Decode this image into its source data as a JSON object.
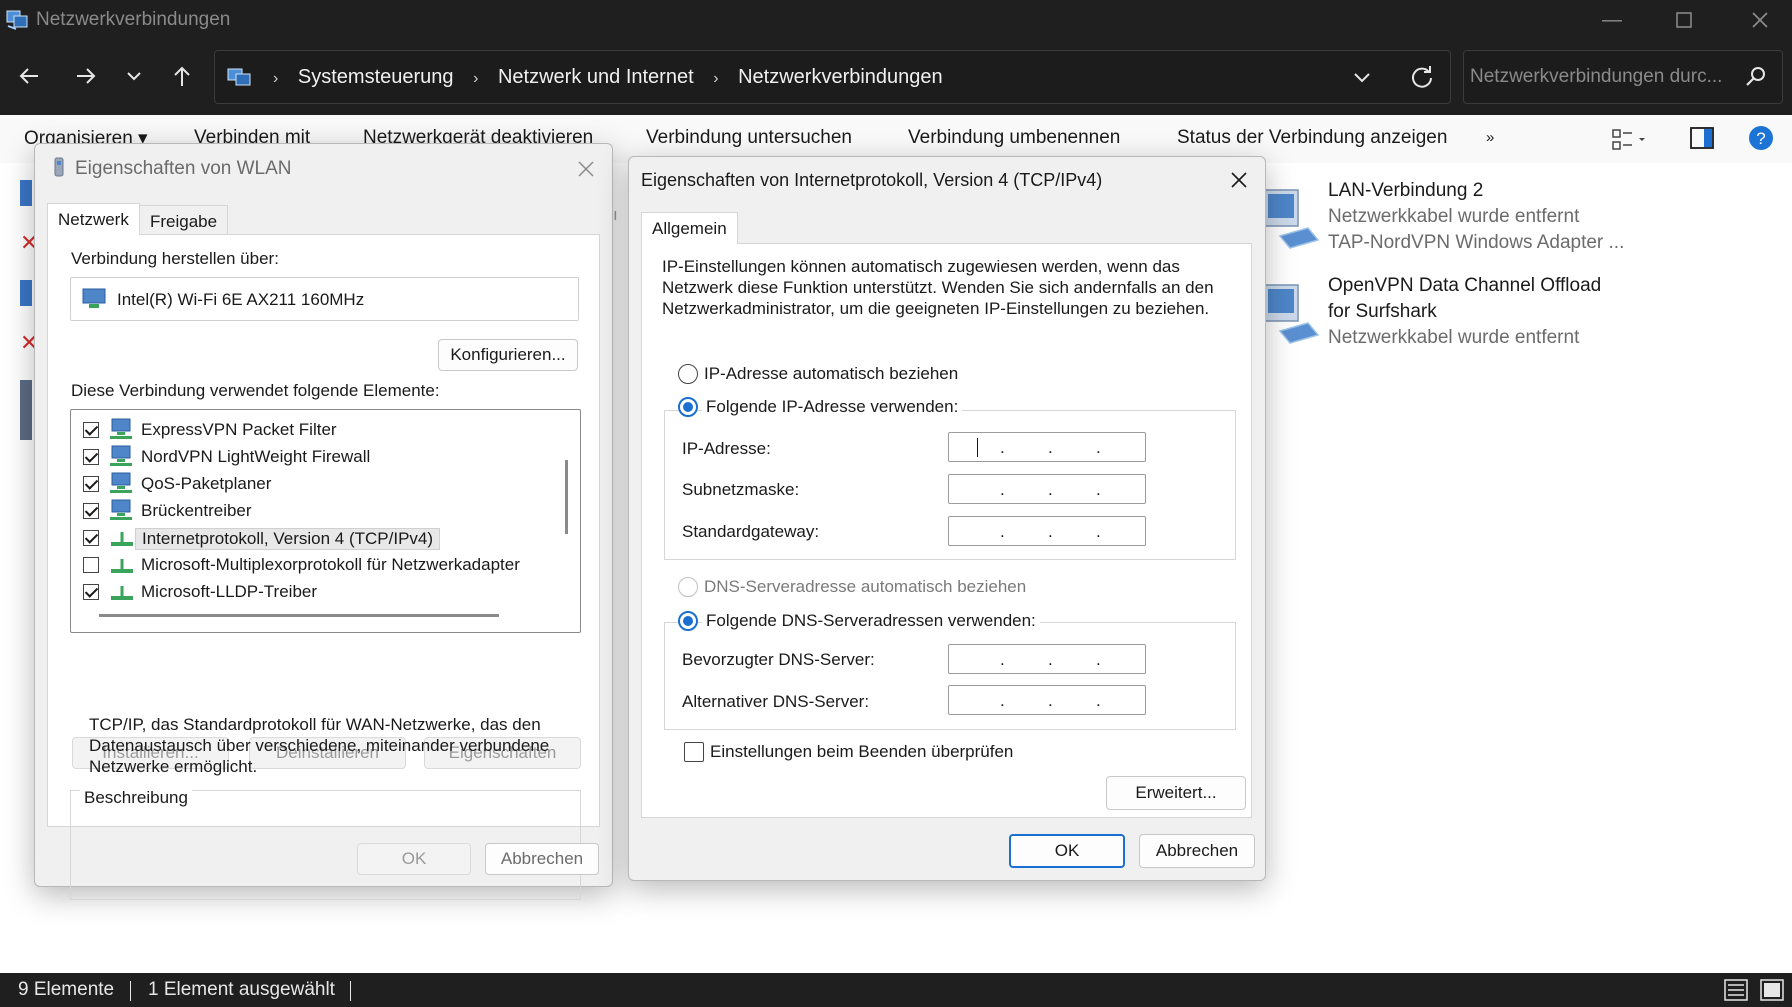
{
  "window": {
    "title": "Netzwerkverbindungen"
  },
  "address": {
    "crumbs": [
      "Systemsteuerung",
      "Netzwerk und Internet",
      "Netzwerkverbindungen"
    ],
    "search_placeholder": "Netzwerkverbindungen durc..."
  },
  "commandbar": {
    "organize": "Organisieren ▾",
    "connect_to": "Verbinden mit",
    "disable_device": "Netzwerkgerät deaktivieren",
    "diagnose": "Verbindung untersuchen",
    "rename": "Verbindung umbenennen",
    "status": "Status der Verbindung anzeigen",
    "more": "»"
  },
  "connections": [
    {
      "name": "LAN-Verbindung 2",
      "line2": "Netzwerkkabel wurde entfernt",
      "line3": "TAP-NordVPN Windows Adapter ..."
    },
    {
      "name": "OpenVPN Data Channel Offload",
      "line2": "for Surfshark",
      "line3": "Netzwerkkabel wurde entfernt"
    }
  ],
  "statusbar": {
    "count": "9 Elemente",
    "selected": "1 Element ausgewählt"
  },
  "wlan_dialog": {
    "title": "Eigenschaften von WLAN",
    "tabs": [
      "Netzwerk",
      "Freigabe"
    ],
    "connect_via_label": "Verbindung herstellen über:",
    "adapter": "Intel(R) Wi-Fi 6E AX211 160MHz",
    "configure": "Konfigurieren...",
    "elements_label": "Diese Verbindung verwendet folgende Elemente:",
    "items": [
      {
        "label": "ExpressVPN Packet Filter",
        "checked": true
      },
      {
        "label": "NordVPN LightWeight Firewall",
        "checked": true
      },
      {
        "label": "QoS-Paketplaner",
        "checked": true
      },
      {
        "label": "Brückentreiber",
        "checked": true
      },
      {
        "label": "Internetprotokoll, Version 4 (TCP/IPv4)",
        "checked": true
      },
      {
        "label": "Microsoft-Multiplexorprotokoll für Netzwerkadapter",
        "checked": false
      },
      {
        "label": "Microsoft-LLDP-Treiber",
        "checked": true
      }
    ],
    "install": "Installieren...",
    "uninstall": "Deinstallieren",
    "properties": "Eigenschaften",
    "description_title": "Beschreibung",
    "description": "TCP/IP, das Standardprotokoll für WAN-Netzwerke, das den Datenaustausch über verschiedene, miteinander verbundene Netzwerke ermöglicht.",
    "ok": "OK",
    "cancel": "Abbrechen"
  },
  "ipv4_dialog": {
    "title": "Eigenschaften von Internetprotokoll, Version 4 (TCP/IPv4)",
    "tab": "Allgemein",
    "intro": "IP-Einstellungen können automatisch zugewiesen werden, wenn das Netzwerk diese Funktion unterstützt. Wenden Sie sich andernfalls an den Netzwerkadministrator, um die geeigneten IP-Einstellungen zu beziehen.",
    "ip_auto": "IP-Adresse automatisch beziehen",
    "ip_manual": "Folgende IP-Adresse verwenden:",
    "ip_label": "IP-Adresse:",
    "subnet_label": "Subnetzmaske:",
    "gateway_label": "Standardgateway:",
    "dns_auto": "DNS-Serveradresse automatisch beziehen",
    "dns_manual": "Folgende DNS-Serveradressen verwenden:",
    "dns_preferred_label": "Bevorzugter DNS-Server:",
    "dns_alt_label": "Alternativer DNS-Server:",
    "validate": "Einstellungen beim Beenden überprüfen",
    "advanced": "Erweitert...",
    "ok": "OK",
    "cancel": "Abbrechen",
    "ip_dot": "."
  }
}
